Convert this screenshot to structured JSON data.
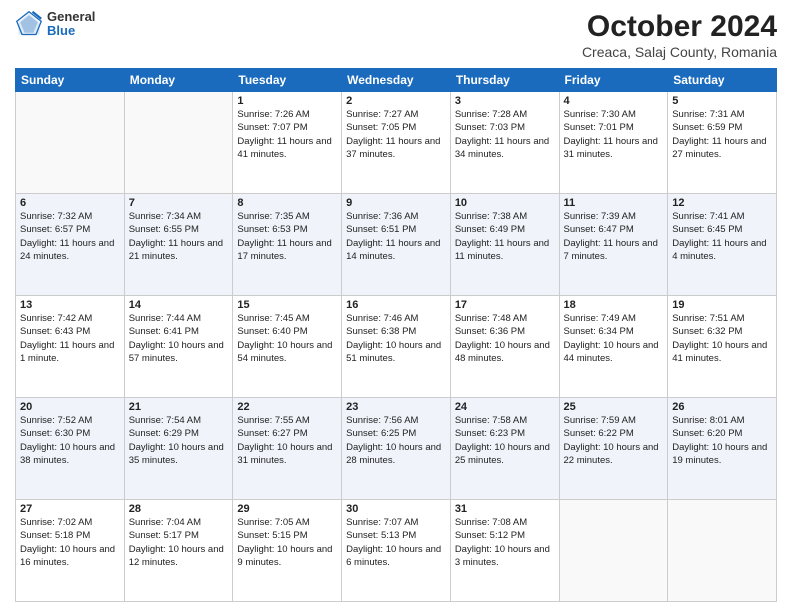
{
  "header": {
    "logo": {
      "general": "General",
      "blue": "Blue"
    },
    "title": "October 2024",
    "subtitle": "Creaca, Salaj County, Romania"
  },
  "days_of_week": [
    "Sunday",
    "Monday",
    "Tuesday",
    "Wednesday",
    "Thursday",
    "Friday",
    "Saturday"
  ],
  "weeks": [
    [
      {
        "day": "",
        "detail": ""
      },
      {
        "day": "",
        "detail": ""
      },
      {
        "day": "1",
        "detail": "Sunrise: 7:26 AM\nSunset: 7:07 PM\nDaylight: 11 hours and 41 minutes."
      },
      {
        "day": "2",
        "detail": "Sunrise: 7:27 AM\nSunset: 7:05 PM\nDaylight: 11 hours and 37 minutes."
      },
      {
        "day": "3",
        "detail": "Sunrise: 7:28 AM\nSunset: 7:03 PM\nDaylight: 11 hours and 34 minutes."
      },
      {
        "day": "4",
        "detail": "Sunrise: 7:30 AM\nSunset: 7:01 PM\nDaylight: 11 hours and 31 minutes."
      },
      {
        "day": "5",
        "detail": "Sunrise: 7:31 AM\nSunset: 6:59 PM\nDaylight: 11 hours and 27 minutes."
      }
    ],
    [
      {
        "day": "6",
        "detail": "Sunrise: 7:32 AM\nSunset: 6:57 PM\nDaylight: 11 hours and 24 minutes."
      },
      {
        "day": "7",
        "detail": "Sunrise: 7:34 AM\nSunset: 6:55 PM\nDaylight: 11 hours and 21 minutes."
      },
      {
        "day": "8",
        "detail": "Sunrise: 7:35 AM\nSunset: 6:53 PM\nDaylight: 11 hours and 17 minutes."
      },
      {
        "day": "9",
        "detail": "Sunrise: 7:36 AM\nSunset: 6:51 PM\nDaylight: 11 hours and 14 minutes."
      },
      {
        "day": "10",
        "detail": "Sunrise: 7:38 AM\nSunset: 6:49 PM\nDaylight: 11 hours and 11 minutes."
      },
      {
        "day": "11",
        "detail": "Sunrise: 7:39 AM\nSunset: 6:47 PM\nDaylight: 11 hours and 7 minutes."
      },
      {
        "day": "12",
        "detail": "Sunrise: 7:41 AM\nSunset: 6:45 PM\nDaylight: 11 hours and 4 minutes."
      }
    ],
    [
      {
        "day": "13",
        "detail": "Sunrise: 7:42 AM\nSunset: 6:43 PM\nDaylight: 11 hours and 1 minute."
      },
      {
        "day": "14",
        "detail": "Sunrise: 7:44 AM\nSunset: 6:41 PM\nDaylight: 10 hours and 57 minutes."
      },
      {
        "day": "15",
        "detail": "Sunrise: 7:45 AM\nSunset: 6:40 PM\nDaylight: 10 hours and 54 minutes."
      },
      {
        "day": "16",
        "detail": "Sunrise: 7:46 AM\nSunset: 6:38 PM\nDaylight: 10 hours and 51 minutes."
      },
      {
        "day": "17",
        "detail": "Sunrise: 7:48 AM\nSunset: 6:36 PM\nDaylight: 10 hours and 48 minutes."
      },
      {
        "day": "18",
        "detail": "Sunrise: 7:49 AM\nSunset: 6:34 PM\nDaylight: 10 hours and 44 minutes."
      },
      {
        "day": "19",
        "detail": "Sunrise: 7:51 AM\nSunset: 6:32 PM\nDaylight: 10 hours and 41 minutes."
      }
    ],
    [
      {
        "day": "20",
        "detail": "Sunrise: 7:52 AM\nSunset: 6:30 PM\nDaylight: 10 hours and 38 minutes."
      },
      {
        "day": "21",
        "detail": "Sunrise: 7:54 AM\nSunset: 6:29 PM\nDaylight: 10 hours and 35 minutes."
      },
      {
        "day": "22",
        "detail": "Sunrise: 7:55 AM\nSunset: 6:27 PM\nDaylight: 10 hours and 31 minutes."
      },
      {
        "day": "23",
        "detail": "Sunrise: 7:56 AM\nSunset: 6:25 PM\nDaylight: 10 hours and 28 minutes."
      },
      {
        "day": "24",
        "detail": "Sunrise: 7:58 AM\nSunset: 6:23 PM\nDaylight: 10 hours and 25 minutes."
      },
      {
        "day": "25",
        "detail": "Sunrise: 7:59 AM\nSunset: 6:22 PM\nDaylight: 10 hours and 22 minutes."
      },
      {
        "day": "26",
        "detail": "Sunrise: 8:01 AM\nSunset: 6:20 PM\nDaylight: 10 hours and 19 minutes."
      }
    ],
    [
      {
        "day": "27",
        "detail": "Sunrise: 7:02 AM\nSunset: 5:18 PM\nDaylight: 10 hours and 16 minutes."
      },
      {
        "day": "28",
        "detail": "Sunrise: 7:04 AM\nSunset: 5:17 PM\nDaylight: 10 hours and 12 minutes."
      },
      {
        "day": "29",
        "detail": "Sunrise: 7:05 AM\nSunset: 5:15 PM\nDaylight: 10 hours and 9 minutes."
      },
      {
        "day": "30",
        "detail": "Sunrise: 7:07 AM\nSunset: 5:13 PM\nDaylight: 10 hours and 6 minutes."
      },
      {
        "day": "31",
        "detail": "Sunrise: 7:08 AM\nSunset: 5:12 PM\nDaylight: 10 hours and 3 minutes."
      },
      {
        "day": "",
        "detail": ""
      },
      {
        "day": "",
        "detail": ""
      }
    ]
  ]
}
